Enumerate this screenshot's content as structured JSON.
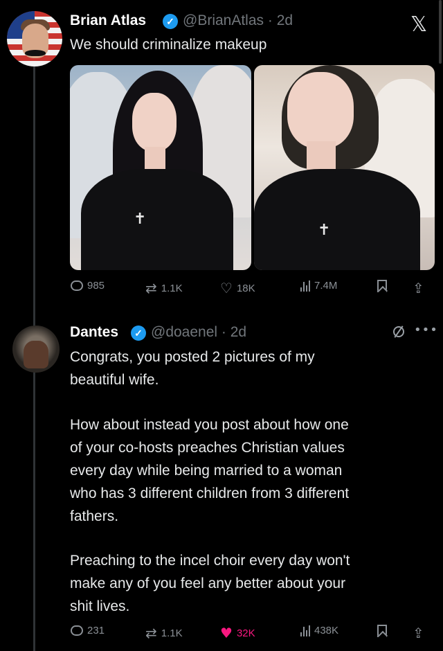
{
  "tweet": {
    "author_name": "Brian Atlas",
    "handle_time": "@BrianAtlas · 2d",
    "text": "We should criminalize makeup",
    "actions": {
      "replies": "985",
      "reposts": "1.1K",
      "likes": "18K",
      "views": "7.4M"
    }
  },
  "reply": {
    "author_name": "Dantes",
    "handle_time": "@doaenel · 2d",
    "paragraphs": [
      [
        "Congrats, you posted 2 pictures of my",
        "beautiful wife."
      ],
      [
        "How about instead you post about how one",
        "of your co-hosts preaches Christian values",
        "every day while being married to a woman",
        "who has 3 different children from 3 different",
        "fathers."
      ],
      [
        "Preaching to the incel choir every day won't",
        "make any of you feel any better about your",
        "shit lives."
      ]
    ],
    "actions": {
      "replies": "231",
      "reposts": "1.1K",
      "likes": "32K",
      "views": "438K",
      "liked": true
    }
  },
  "icons": {
    "app_logo": "x-logo-icon",
    "verified": "verified-badge-icon",
    "reply": "reply-icon",
    "repost": "repost-icon",
    "like": "heart-icon",
    "views": "views-icon",
    "bookmark": "bookmark-icon",
    "share": "share-icon",
    "grok": "grok-icon",
    "more": "more-icon"
  },
  "colors": {
    "background": "#000000",
    "text": "#e7e9ea",
    "muted": "#71767b",
    "verified": "#1d9bf0",
    "like_active": "#f91880"
  }
}
